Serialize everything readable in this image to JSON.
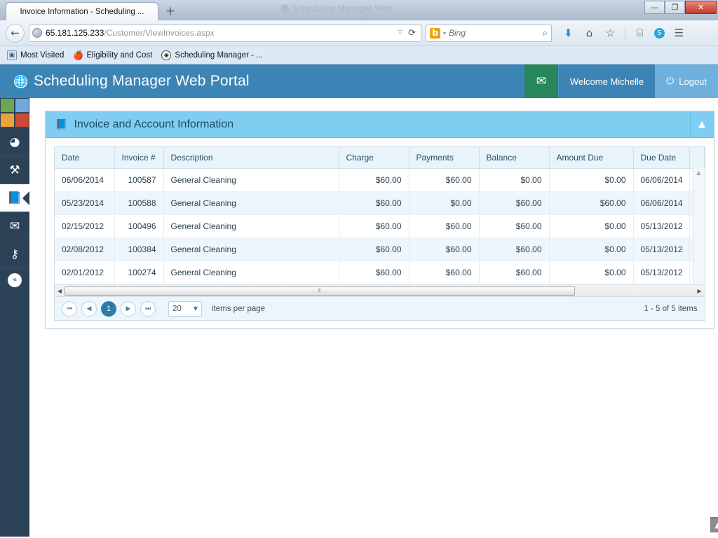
{
  "browser": {
    "tab_title": "Invoice Information - Scheduling ...",
    "new_tab_label": "+",
    "ghost_window_title": "Scheduling Manager Web ...",
    "back_icon": "←",
    "url_prefix": "65.181.125.233",
    "url_suffix": "/Customer/ViewInvoices.aspx",
    "url_dropdown_icon": "▽",
    "reload_icon": "⟳",
    "search_engine": "b",
    "search_placeholder": "Bing",
    "search_icon": "⌕",
    "toolbar_icons": [
      "⬇",
      "⌂",
      "☆",
      "⌸",
      "S",
      "☰"
    ],
    "window_buttons": [
      "—",
      "❐",
      "✕"
    ],
    "bookmarks": [
      {
        "label": "Most Visited",
        "icon": "▣"
      },
      {
        "label": "Eligibility and Cost",
        "icon": "●"
      },
      {
        "label": "Scheduling Manager - ...",
        "icon": "◉"
      }
    ]
  },
  "app": {
    "title": "Scheduling Manager Web Portal",
    "globe_icon": "⊕",
    "mail_icon": "✉",
    "welcome_text": "Welcome Michelle",
    "logout_label": "Logout",
    "power_icon": "⏻",
    "colors": {
      "header_blue": "#3c84b5",
      "mail_green": "#27865a",
      "logout_blue": "#6fb1dc",
      "sidebar_navy": "#2c4257",
      "panel_head_blue": "#7fcdf0",
      "accent_pager": "#2b7ca8"
    }
  },
  "sidebar": {
    "logo_colors": [
      "#6aa84f",
      "#6fa8dc",
      "#e8a33d",
      "#cc4b37"
    ],
    "items": [
      {
        "name": "dashboard",
        "icon": "◔"
      },
      {
        "name": "tools",
        "icon": "⚒"
      },
      {
        "name": "invoices",
        "icon": "❐",
        "active": true
      },
      {
        "name": "messages",
        "icon": "✉"
      },
      {
        "name": "security",
        "icon": "⚷"
      }
    ],
    "collapse_icon": "«"
  },
  "panel": {
    "title": "Invoice and Account Information",
    "title_icon": "❐",
    "toggle_icon": "▲"
  },
  "grid": {
    "columns": [
      "Date",
      "Invoice #",
      "Description",
      "Charge",
      "Payments",
      "Balance",
      "Amount Due",
      "Due Date"
    ],
    "rows": [
      {
        "date": "06/06/2014",
        "invoice": "100587",
        "description": "General Cleaning",
        "charge": "$60.00",
        "payments": "$60.00",
        "balance": "$0.00",
        "amount_due": "$0.00",
        "due_date": "06/06/2014"
      },
      {
        "date": "05/23/2014",
        "invoice": "100588",
        "description": "General Cleaning",
        "charge": "$60.00",
        "payments": "$0.00",
        "balance": "$60.00",
        "amount_due": "$60.00",
        "due_date": "06/06/2014"
      },
      {
        "date": "02/15/2012",
        "invoice": "100496",
        "description": "General Cleaning",
        "charge": "$60.00",
        "payments": "$60.00",
        "balance": "$60.00",
        "amount_due": "$0.00",
        "due_date": "05/13/2012"
      },
      {
        "date": "02/08/2012",
        "invoice": "100384",
        "description": "General Cleaning",
        "charge": "$60.00",
        "payments": "$60.00",
        "balance": "$60.00",
        "amount_due": "$0.00",
        "due_date": "05/13/2012"
      },
      {
        "date": "02/01/2012",
        "invoice": "100274",
        "description": "General Cleaning",
        "charge": "$60.00",
        "payments": "$60.00",
        "balance": "$60.00",
        "amount_due": "$0.00",
        "due_date": "05/13/2012"
      }
    ],
    "vscroll_up": "▲",
    "vscroll_down": "▼",
    "hscroll_left": "◀",
    "hscroll_right": "▶",
    "hscroll_grip": "⦀"
  },
  "pager": {
    "first_icon": "⏮",
    "prev_icon": "◀",
    "current_page": "1",
    "next_icon": "▶",
    "last_icon": "⏭",
    "page_size": "20",
    "page_size_caret": "▼",
    "items_per_page_label": "items per page",
    "range_text": "1 - 5 of 5 items"
  },
  "scroll_top": {
    "icon": "▲"
  }
}
